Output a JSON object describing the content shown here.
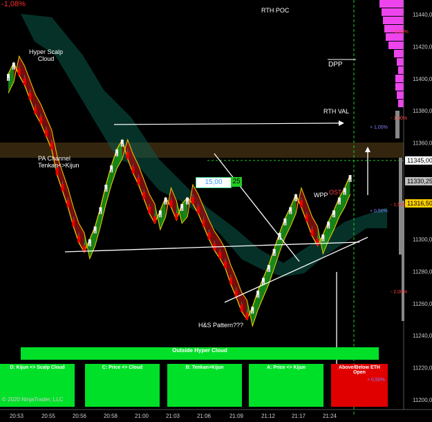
{
  "chart_data": {
    "type": "candlestick",
    "percent_change": "-1,08%",
    "y_axis": {
      "ticks": [
        "11440,00",
        "11420,00",
        "11400,00",
        "11380,00",
        "11360,00",
        "11345,00",
        "11330,25",
        "11316,50",
        "11300,00",
        "11280,00",
        "11260,00",
        "11240,00",
        "11220,00",
        "11200,00"
      ],
      "ylim": [
        11194,
        11449
      ]
    },
    "x_axis": {
      "ticks": [
        "20:53",
        "20:55",
        "20:56",
        "20:58",
        "21:00",
        "21:03",
        "21:06",
        "21:09",
        "21:12",
        "21:17",
        "21:24"
      ]
    },
    "price_tags": {
      "last": "11345,00",
      "ask": "11330,25",
      "bid": "11316,50"
    },
    "levels": {
      "rth_poc": "RTH POC",
      "dpp": "DPP",
      "rth_val": "RTH VAL",
      "wpp": "WPP",
      "ost": "OST"
    },
    "percent_markers": [
      "+ 1,00%",
      "+ 0,50%",
      "- 1,00%",
      "- 1,50%",
      "- 2,00%",
      "+ 0,50%"
    ],
    "order_entry": {
      "price": "15,00",
      "qty": "25"
    },
    "annotations": {
      "hyper_scalp_cloud": "Hyper Scalp\nCloud",
      "pa_channel": "PA Channel\nTenkan<>Kijun",
      "hs_pattern": "H&S Pattern???"
    },
    "bars_note": "Renko style bars; red = down, white = up",
    "bars": [
      11403,
      11410,
      11402,
      11396,
      11387,
      11378,
      11372,
      11364,
      11356,
      11340,
      11330,
      11320,
      11308,
      11298,
      11292,
      11300,
      11308,
      11320,
      11334,
      11346,
      11356,
      11362,
      11350,
      11341,
      11334,
      11325,
      11316,
      11310,
      11318,
      11326,
      11320,
      11312,
      11322,
      11326,
      11322,
      11316,
      11308,
      11300,
      11293,
      11288,
      11282,
      11272,
      11264,
      11255,
      11250,
      11258,
      11268,
      11276,
      11284,
      11294,
      11304,
      11313,
      11320,
      11328,
      11320,
      11311,
      11302,
      11296,
      11303,
      11311,
      11318,
      11326,
      11332,
      11340
    ]
  },
  "panels": [
    {
      "label": "D: Kijun <> Scalp Cloud",
      "color": "#00e028"
    },
    {
      "label": "C: Price <> Cloud",
      "color": "#00e028"
    },
    {
      "label": "B: Tenkan>Kijun",
      "color": "#00e028"
    },
    {
      "label": "A: Price <> Kijun",
      "color": "#00e028"
    },
    {
      "label": "Above/Below ETH\nOpen",
      "color": "#e00000"
    }
  ],
  "outside_banner": "Outside Hyper Cloud",
  "copyright": "© 2020 NinjaTrader, LLC",
  "panel_pct": "+ 0,50%"
}
